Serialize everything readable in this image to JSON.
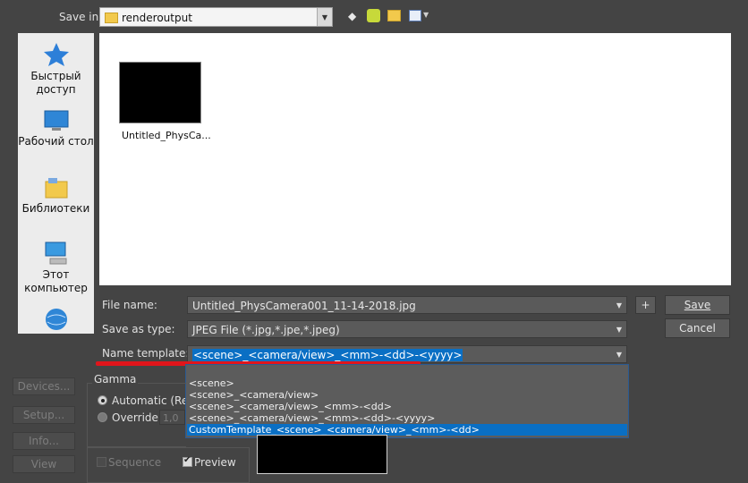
{
  "header": {
    "save_in_label": "Save in:",
    "folder": "renderoutput"
  },
  "places": [
    {
      "label": "Быстрый доступ",
      "icon": "star-icon"
    },
    {
      "label": "Рабочий стол",
      "icon": "desktop-icon"
    },
    {
      "label": "Библиотеки",
      "icon": "libraries-icon"
    },
    {
      "label": "Этот компьютер",
      "icon": "computer-icon"
    },
    {
      "label": "",
      "icon": "network-icon"
    }
  ],
  "files": [
    {
      "name": "Untitled_PhysCa..."
    }
  ],
  "form": {
    "file_name_label": "File name:",
    "file_name_value": "Untitled_PhysCamera001_11-14-2018.jpg",
    "save_as_type_label": "Save as type:",
    "save_as_type_value": "JPEG File (*.jpg,*.jpe,*.jpeg)",
    "name_template_label": "Name template:",
    "name_template_value": "<scene>_<camera/view>_<mm>-<dd>-<yyyy>",
    "plus_label": "+",
    "save_label": "Save",
    "cancel_label": "Cancel"
  },
  "template_options": [
    "<scene>",
    "<scene>_<camera/view>",
    "<scene>_<camera/view>_<mm>-<dd>",
    "<scene>_<camera/view>_<mm>-<dd>-<yyyy>",
    "CustomTemplate_<scene>_<camera/view>_<mm>-<dd>"
  ],
  "template_selected_index": 4,
  "side_buttons": {
    "devices": "Devices...",
    "setup": "Setup...",
    "info": "Info...",
    "view": "View"
  },
  "gamma": {
    "title": "Gamma",
    "automatic": "Automatic (Recor",
    "override": "Override",
    "override_value": "1,0"
  },
  "options": {
    "sequence": "Sequence",
    "preview": "Preview"
  },
  "colors": {
    "accent": "#0a6fc4",
    "annotation": "#e0151b"
  }
}
